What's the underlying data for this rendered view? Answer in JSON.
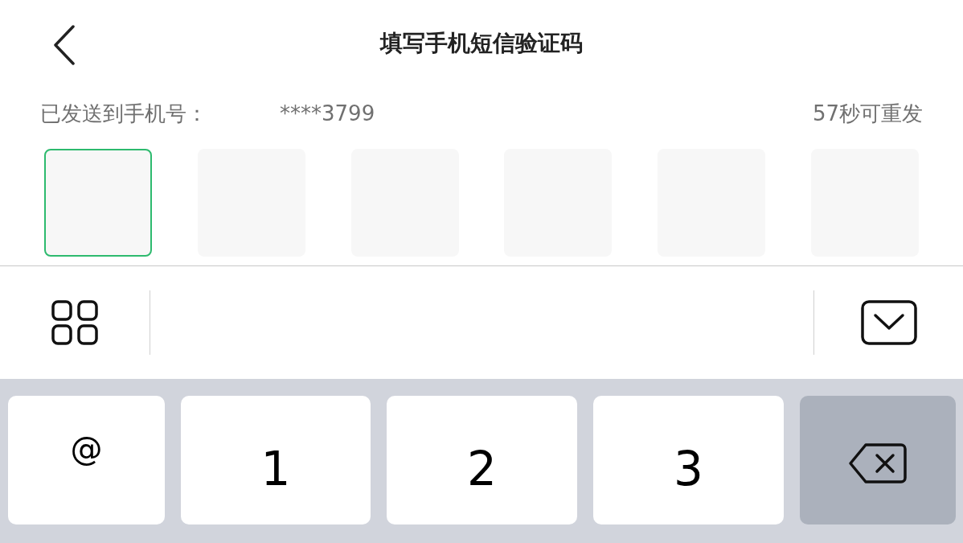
{
  "header": {
    "title": "填写手机短信验证码"
  },
  "info": {
    "sent_label": "已发送到手机号：",
    "phone": "****3799",
    "resend": "57秒可重发"
  },
  "code_boxes": [
    {
      "selected": true
    },
    {
      "selected": false
    },
    {
      "selected": false
    },
    {
      "selected": false
    },
    {
      "selected": false
    },
    {
      "selected": false
    }
  ],
  "keys": [
    {
      "kind": "symbol",
      "label": "@"
    },
    {
      "kind": "digit",
      "label": "1"
    },
    {
      "kind": "digit",
      "label": "2"
    },
    {
      "kind": "digit",
      "label": "3"
    },
    {
      "kind": "delete"
    }
  ]
}
